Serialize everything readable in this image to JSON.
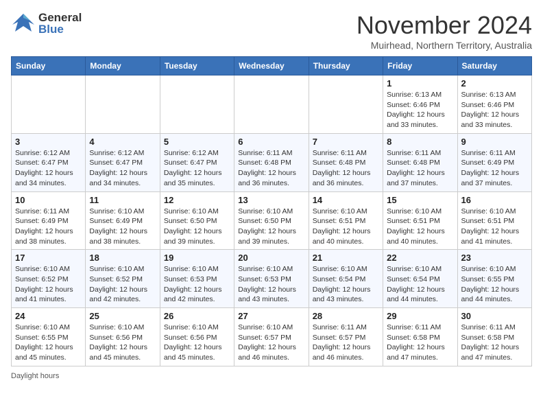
{
  "header": {
    "logo_general": "General",
    "logo_blue": "Blue",
    "month_title": "November 2024",
    "location": "Muirhead, Northern Territory, Australia"
  },
  "calendar": {
    "days_of_week": [
      "Sunday",
      "Monday",
      "Tuesday",
      "Wednesday",
      "Thursday",
      "Friday",
      "Saturday"
    ],
    "weeks": [
      [
        {
          "day": "",
          "info": ""
        },
        {
          "day": "",
          "info": ""
        },
        {
          "day": "",
          "info": ""
        },
        {
          "day": "",
          "info": ""
        },
        {
          "day": "",
          "info": ""
        },
        {
          "day": "1",
          "info": "Sunrise: 6:13 AM\nSunset: 6:46 PM\nDaylight: 12 hours\nand 33 minutes."
        },
        {
          "day": "2",
          "info": "Sunrise: 6:13 AM\nSunset: 6:46 PM\nDaylight: 12 hours\nand 33 minutes."
        }
      ],
      [
        {
          "day": "3",
          "info": "Sunrise: 6:12 AM\nSunset: 6:47 PM\nDaylight: 12 hours\nand 34 minutes."
        },
        {
          "day": "4",
          "info": "Sunrise: 6:12 AM\nSunset: 6:47 PM\nDaylight: 12 hours\nand 34 minutes."
        },
        {
          "day": "5",
          "info": "Sunrise: 6:12 AM\nSunset: 6:47 PM\nDaylight: 12 hours\nand 35 minutes."
        },
        {
          "day": "6",
          "info": "Sunrise: 6:11 AM\nSunset: 6:48 PM\nDaylight: 12 hours\nand 36 minutes."
        },
        {
          "day": "7",
          "info": "Sunrise: 6:11 AM\nSunset: 6:48 PM\nDaylight: 12 hours\nand 36 minutes."
        },
        {
          "day": "8",
          "info": "Sunrise: 6:11 AM\nSunset: 6:48 PM\nDaylight: 12 hours\nand 37 minutes."
        },
        {
          "day": "9",
          "info": "Sunrise: 6:11 AM\nSunset: 6:49 PM\nDaylight: 12 hours\nand 37 minutes."
        }
      ],
      [
        {
          "day": "10",
          "info": "Sunrise: 6:11 AM\nSunset: 6:49 PM\nDaylight: 12 hours\nand 38 minutes."
        },
        {
          "day": "11",
          "info": "Sunrise: 6:10 AM\nSunset: 6:49 PM\nDaylight: 12 hours\nand 38 minutes."
        },
        {
          "day": "12",
          "info": "Sunrise: 6:10 AM\nSunset: 6:50 PM\nDaylight: 12 hours\nand 39 minutes."
        },
        {
          "day": "13",
          "info": "Sunrise: 6:10 AM\nSunset: 6:50 PM\nDaylight: 12 hours\nand 39 minutes."
        },
        {
          "day": "14",
          "info": "Sunrise: 6:10 AM\nSunset: 6:51 PM\nDaylight: 12 hours\nand 40 minutes."
        },
        {
          "day": "15",
          "info": "Sunrise: 6:10 AM\nSunset: 6:51 PM\nDaylight: 12 hours\nand 40 minutes."
        },
        {
          "day": "16",
          "info": "Sunrise: 6:10 AM\nSunset: 6:51 PM\nDaylight: 12 hours\nand 41 minutes."
        }
      ],
      [
        {
          "day": "17",
          "info": "Sunrise: 6:10 AM\nSunset: 6:52 PM\nDaylight: 12 hours\nand 41 minutes."
        },
        {
          "day": "18",
          "info": "Sunrise: 6:10 AM\nSunset: 6:52 PM\nDaylight: 12 hours\nand 42 minutes."
        },
        {
          "day": "19",
          "info": "Sunrise: 6:10 AM\nSunset: 6:53 PM\nDaylight: 12 hours\nand 42 minutes."
        },
        {
          "day": "20",
          "info": "Sunrise: 6:10 AM\nSunset: 6:53 PM\nDaylight: 12 hours\nand 43 minutes."
        },
        {
          "day": "21",
          "info": "Sunrise: 6:10 AM\nSunset: 6:54 PM\nDaylight: 12 hours\nand 43 minutes."
        },
        {
          "day": "22",
          "info": "Sunrise: 6:10 AM\nSunset: 6:54 PM\nDaylight: 12 hours\nand 44 minutes."
        },
        {
          "day": "23",
          "info": "Sunrise: 6:10 AM\nSunset: 6:55 PM\nDaylight: 12 hours\nand 44 minutes."
        }
      ],
      [
        {
          "day": "24",
          "info": "Sunrise: 6:10 AM\nSunset: 6:55 PM\nDaylight: 12 hours\nand 45 minutes."
        },
        {
          "day": "25",
          "info": "Sunrise: 6:10 AM\nSunset: 6:56 PM\nDaylight: 12 hours\nand 45 minutes."
        },
        {
          "day": "26",
          "info": "Sunrise: 6:10 AM\nSunset: 6:56 PM\nDaylight: 12 hours\nand 45 minutes."
        },
        {
          "day": "27",
          "info": "Sunrise: 6:10 AM\nSunset: 6:57 PM\nDaylight: 12 hours\nand 46 minutes."
        },
        {
          "day": "28",
          "info": "Sunrise: 6:11 AM\nSunset: 6:57 PM\nDaylight: 12 hours\nand 46 minutes."
        },
        {
          "day": "29",
          "info": "Sunrise: 6:11 AM\nSunset: 6:58 PM\nDaylight: 12 hours\nand 47 minutes."
        },
        {
          "day": "30",
          "info": "Sunrise: 6:11 AM\nSunset: 6:58 PM\nDaylight: 12 hours\nand 47 minutes."
        }
      ]
    ]
  },
  "footer": {
    "text": "Daylight hours"
  }
}
